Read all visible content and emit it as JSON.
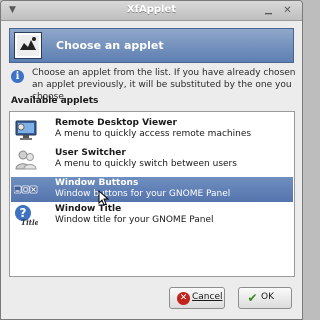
{
  "window": {
    "title": "XfApplet"
  },
  "header": {
    "title": "Choose an applet"
  },
  "info": {
    "text": "Choose an applet from the list. If you have already chosen an applet previously, it will be substituted by the one you choose."
  },
  "list": {
    "label": "Available applets",
    "items": [
      {
        "name": "Remote Desktop Viewer",
        "description": "A menu to quickly access remote machines",
        "icon": "remote-desktop-icon"
      },
      {
        "name": "User Switcher",
        "description": "A menu to quickly switch between users",
        "icon": "user-switcher-icon"
      },
      {
        "name": "Window Buttons",
        "description": "Window buttons for your GNOME Panel",
        "icon": "window-buttons-icon",
        "selected": true
      },
      {
        "name": "Window Title",
        "description": "Window title for your GNOME Panel",
        "icon": "window-title-icon"
      }
    ]
  },
  "buttons": {
    "cancel": "Cancel",
    "ok": "OK"
  },
  "colors": {
    "selection": "#5f7fb6",
    "header_band": "#6f8dbd"
  }
}
